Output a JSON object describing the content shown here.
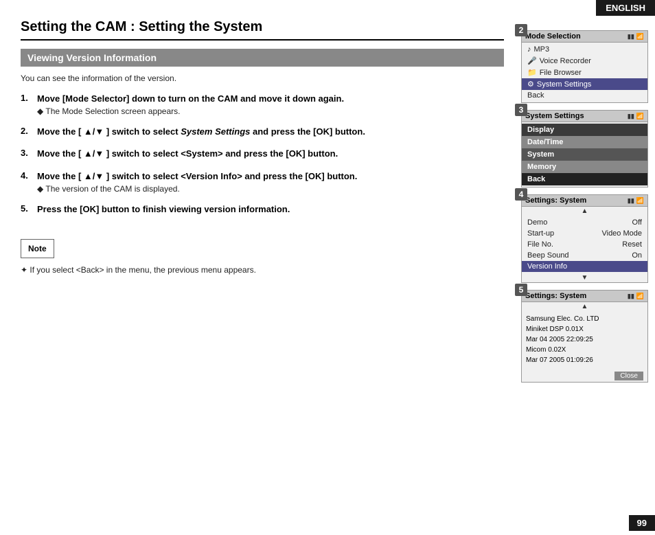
{
  "badge": {
    "language": "ENGLISH"
  },
  "page": {
    "number": "99",
    "title": "Setting the CAM : Setting the System"
  },
  "section": {
    "title": "Viewing Version Information",
    "intro": "You can see the information of the version."
  },
  "steps": [
    {
      "num": "1.",
      "main": "Move [Mode Selector] down to turn on the CAM and move it down again.",
      "sub": "The Mode Selection screen appears."
    },
    {
      "num": "2.",
      "main_before": "Move the [ ▲/▼ ] switch to select ",
      "main_italic": "System Settings",
      "main_after": " and press the [OK] button.",
      "sub": null
    },
    {
      "num": "3.",
      "main": "Move the [ ▲/▼ ] switch to select <System> and press the [OK] button.",
      "sub": null
    },
    {
      "num": "4.",
      "main": "Move the [ ▲/▼ ] switch to select <Version Info> and press the [OK] button.",
      "sub": "The version of the CAM is displayed."
    },
    {
      "num": "5.",
      "main": "Press the [OK] button to finish viewing version information.",
      "sub": null
    }
  ],
  "note": {
    "label": "Note",
    "text": "If you select <Back> in the menu, the previous menu appears."
  },
  "screens": {
    "screen2": {
      "label": "2",
      "title": "Mode Selection",
      "items": [
        {
          "text": "MP3",
          "icon": "♪",
          "selected": false
        },
        {
          "text": "Voice Recorder",
          "icon": "🎤",
          "selected": false
        },
        {
          "text": "File Browser",
          "icon": "📁",
          "selected": false
        },
        {
          "text": "System Settings",
          "icon": "⚙",
          "selected": true
        },
        {
          "text": "Back",
          "icon": "",
          "selected": false
        }
      ]
    },
    "screen3": {
      "label": "3",
      "title": "System Settings",
      "items": [
        {
          "text": "Display",
          "style": "dark"
        },
        {
          "text": "Date/Time",
          "style": "mid"
        },
        {
          "text": "System",
          "style": "dark"
        },
        {
          "text": "Memory",
          "style": "mid"
        },
        {
          "text": "Back",
          "style": "darker"
        }
      ]
    },
    "screen4": {
      "label": "4",
      "title": "Settings: System",
      "arrow_up": true,
      "rows": [
        {
          "label": "Demo",
          "value": "Off",
          "selected": false
        },
        {
          "label": "Start-up",
          "value": "Video Mode",
          "selected": false
        },
        {
          "label": "File No.",
          "value": "Reset",
          "selected": false
        },
        {
          "label": "Beep Sound",
          "value": "On",
          "selected": false
        },
        {
          "label": "Version Info",
          "value": "",
          "selected": true
        }
      ],
      "arrow_down": true
    },
    "screen5": {
      "label": "5",
      "title": "Settings: System",
      "arrow_up": true,
      "version_lines": [
        "Samsung Elec. Co. LTD",
        "Miniket DSP 0.01X",
        "Mar 04 2005 22:09:25",
        "Micom 0.02X",
        "Mar 07 2005 01:09:26"
      ],
      "close_btn": "Close"
    }
  }
}
